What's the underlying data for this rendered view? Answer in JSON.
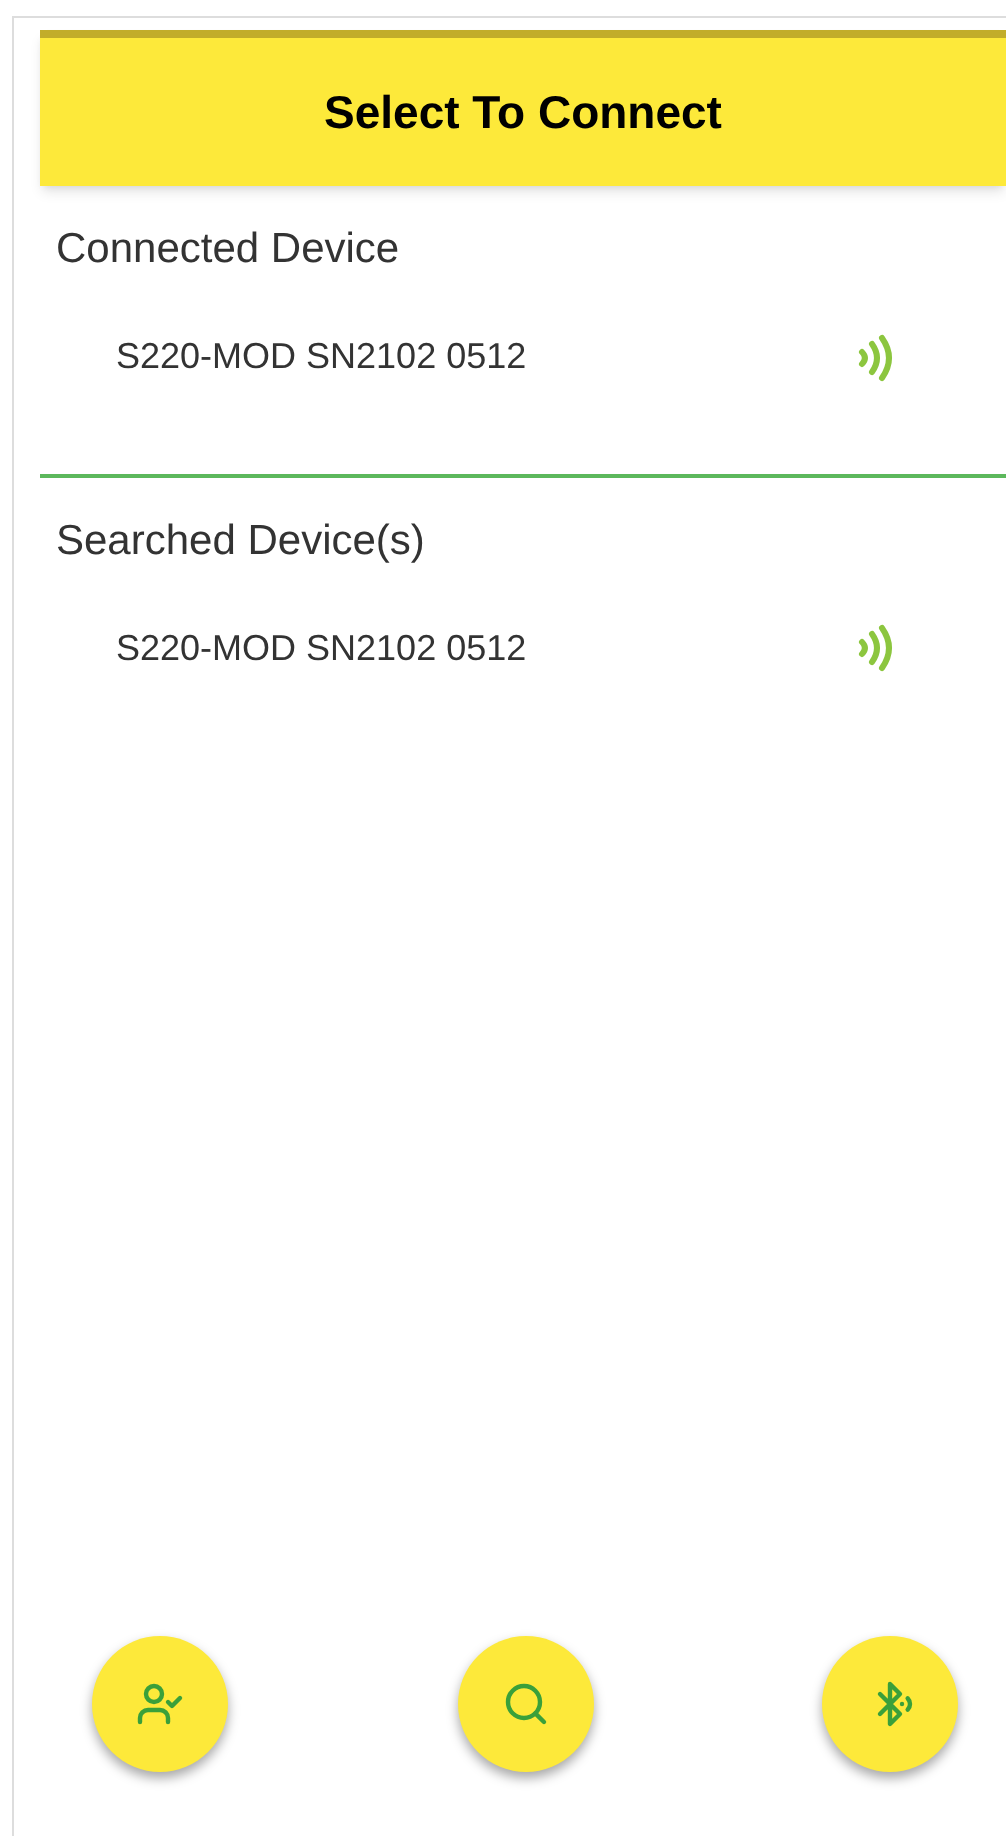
{
  "header": {
    "title": "Select To Connect"
  },
  "sections": [
    {
      "title": "Connected Device",
      "devices": [
        {
          "name": "S220-MOD SN2102 0512"
        }
      ]
    },
    {
      "title": "Searched Device(s)",
      "devices": [
        {
          "name": "S220-MOD SN2102 0512"
        }
      ]
    }
  ],
  "actions": [
    {
      "kind": "connected"
    },
    {
      "kind": "search"
    },
    {
      "kind": "bluetooth"
    }
  ]
}
